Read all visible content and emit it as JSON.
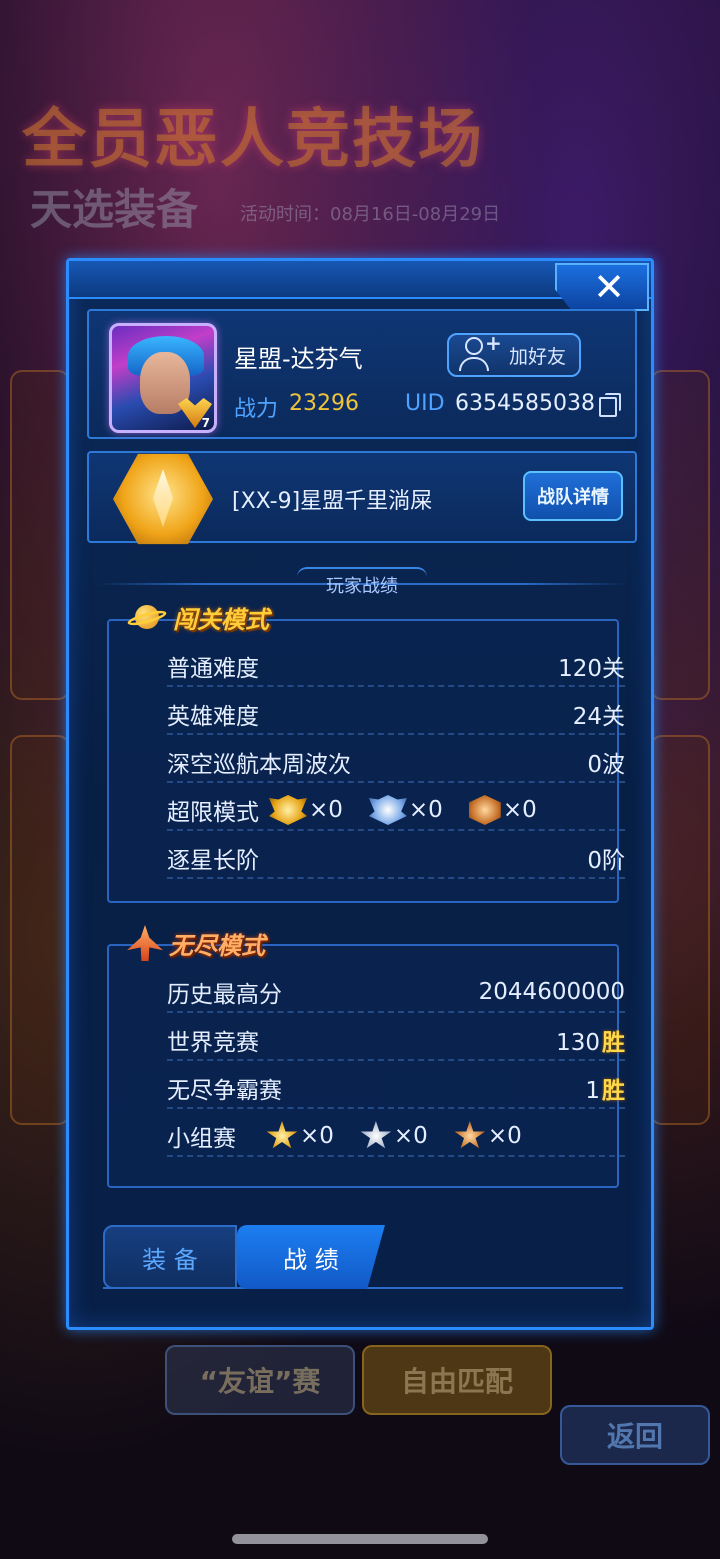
{
  "background": {
    "title": "全员恶人竞技场",
    "subtitle": "天选装备",
    "activity_time": "活动时间：08月16日-08月29日",
    "buttons": [
      "“友谊”赛",
      "自由匹配",
      "返回"
    ]
  },
  "modal": {
    "close_icon": "close-icon",
    "profile": {
      "name": "星盟-达芬气",
      "power_label": "战力",
      "power_value": "23296",
      "uid_label": "UID",
      "uid_value": "6354585038",
      "avatar_rank": "7",
      "add_friend_label": "加好友"
    },
    "team": {
      "name": "[XX-9]星盟千里淌屎",
      "detail_button": "战队详情"
    },
    "section_heading": "玩家战绩",
    "challenge_mode": {
      "title": "闯关模式",
      "rows": [
        {
          "label": "普通难度",
          "value": "120关"
        },
        {
          "label": "英雄难度",
          "value": "24关"
        },
        {
          "label": "深空巡航本周波次",
          "value": "0波"
        },
        {
          "label": "逐星长阶",
          "value": "0阶"
        }
      ],
      "extreme_label": "超限模式",
      "extreme_medals": [
        {
          "icon": "gold-wing-medal-icon",
          "count": "×0"
        },
        {
          "icon": "silver-wing-medal-icon",
          "count": "×0"
        },
        {
          "icon": "bronze-medal-icon",
          "count": "×0"
        }
      ]
    },
    "endless_mode": {
      "title": "无尽模式",
      "rows": [
        {
          "label": "历史最高分",
          "value": "2044600000"
        },
        {
          "label": "世界竞赛",
          "value": "130",
          "suffix": "胜"
        },
        {
          "label": "无尽争霸赛",
          "value": "1",
          "suffix": "胜"
        }
      ],
      "group_label": "小组赛",
      "group_medals": [
        {
          "icon": "gold-star-medal-icon",
          "count": "×0"
        },
        {
          "icon": "silver-star-medal-icon",
          "count": "×0"
        },
        {
          "icon": "bronze-star-medal-icon",
          "count": "×0"
        }
      ]
    },
    "tabs": [
      {
        "label": "装 备",
        "active": false
      },
      {
        "label": "战 绩",
        "active": true
      }
    ]
  }
}
